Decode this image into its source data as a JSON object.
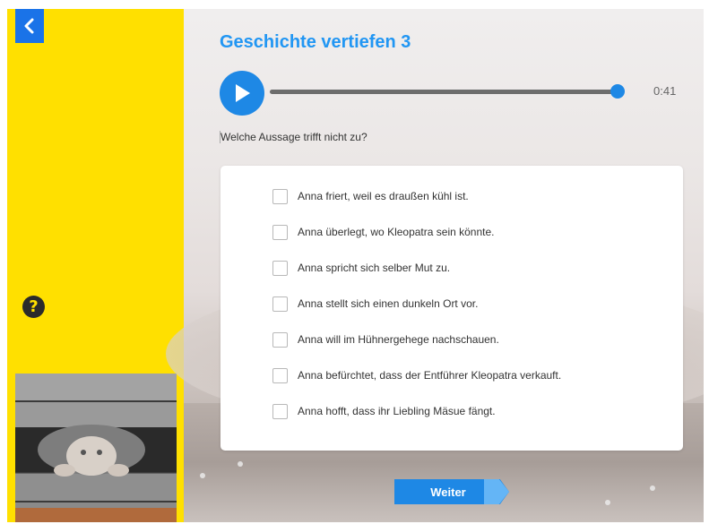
{
  "header": {
    "title": "Geschichte vertiefen 3"
  },
  "audio": {
    "time": "0:41",
    "progress": 1.0
  },
  "question": "Welche Aussage trifft nicht zu?",
  "options": [
    {
      "label": "Anna friert, weil es draußen kühl ist.",
      "checked": false
    },
    {
      "label": "Anna überlegt, wo Kleopatra sein könnte.",
      "checked": false
    },
    {
      "label": "Anna spricht sich selber Mut zu.",
      "checked": false
    },
    {
      "label": "Anna stellt sich einen dunkeln Ort vor.",
      "checked": false
    },
    {
      "label": "Anna will im Hühnergehege nachschauen.",
      "checked": false
    },
    {
      "label": "Anna befürchtet, dass der Entführer Kleopatra verkauft.",
      "checked": false
    },
    {
      "label": "Anna hofft, dass ihr Liebling Mäsue fängt.",
      "checked": false
    }
  ],
  "buttons": {
    "next": "Weiter"
  },
  "colors": {
    "sidebar": "#ffe000",
    "accent": "#1e88e5",
    "title": "#2196f3"
  },
  "icons": {
    "back": "chevron-left-icon",
    "help": "question-mark-icon",
    "play": "play-icon"
  }
}
